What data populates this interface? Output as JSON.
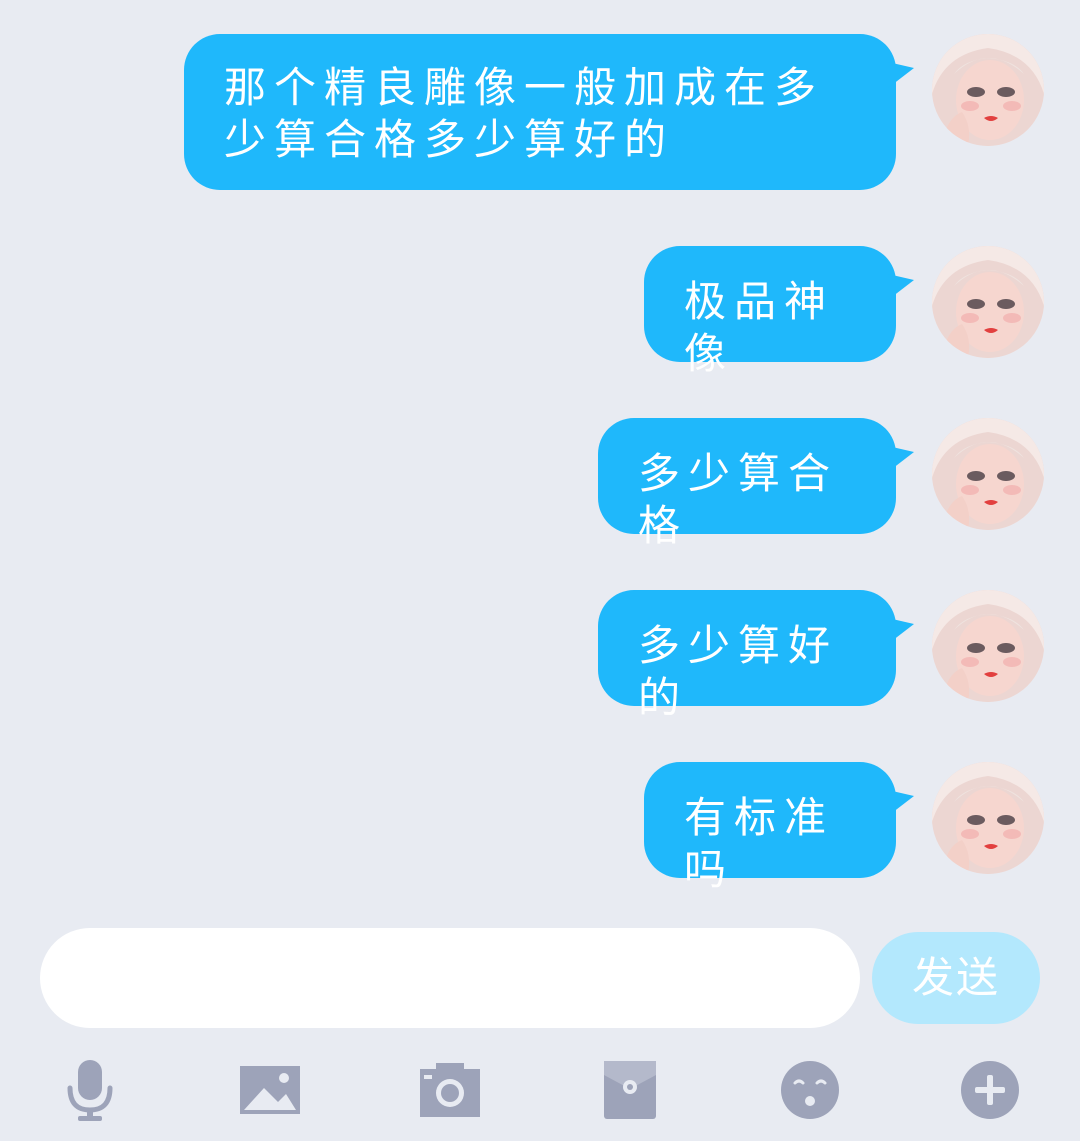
{
  "messages": [
    {
      "text": "那个精良雕像一般加成在多少算合格多少算好的",
      "sender": "self"
    },
    {
      "text": "极品神像",
      "sender": "self"
    },
    {
      "text": "多少算合格",
      "sender": "self"
    },
    {
      "text": "多少算好的",
      "sender": "self"
    },
    {
      "text": "有标准吗",
      "sender": "self"
    }
  ],
  "composer": {
    "input_value": "",
    "placeholder": "",
    "send_label": "发送"
  },
  "toolbar": {
    "icons": [
      "microphone-icon",
      "image-icon",
      "camera-icon",
      "red-packet-icon",
      "emoji-icon",
      "plus-icon"
    ]
  },
  "colors": {
    "background": "#e8ebf2",
    "bubble": "#1fb8fb",
    "send_button": "#b3e8fd",
    "icon": "#9da3b9"
  }
}
